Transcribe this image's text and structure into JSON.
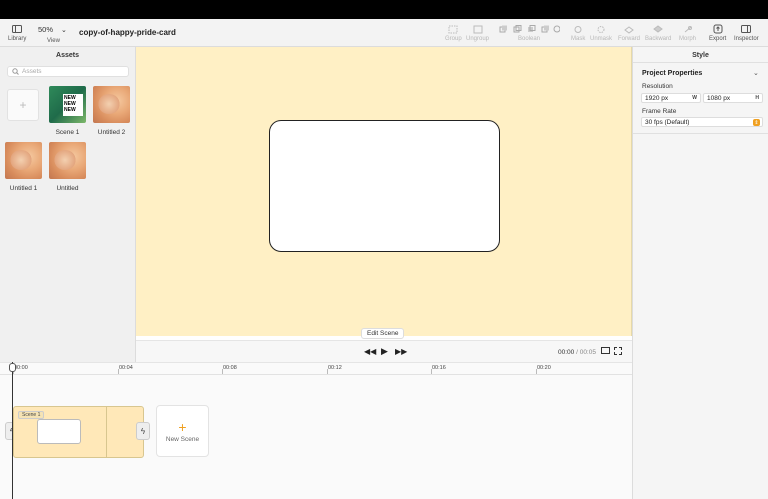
{
  "toolbar": {
    "library_label": "Library",
    "zoom_value": "50%",
    "view_label": "View",
    "doc_title": "copy-of-happy-pride-card",
    "group_label": "Group",
    "ungroup_label": "Ungroup",
    "boolean_label": "Boolean",
    "mask_label": "Mask",
    "unmask_label": "Unmask",
    "forward_label": "Forward",
    "backward_label": "Backward",
    "morph_label": "Morph",
    "export_label": "Export",
    "inspector_label": "Inspector"
  },
  "assets": {
    "title": "Assets",
    "search_placeholder": "Assets",
    "items": [
      {
        "label": "Scene 1"
      },
      {
        "label": "Untitled 2"
      },
      {
        "label": "Untitled 1"
      },
      {
        "label": "Untitled"
      }
    ],
    "scene_thumb_text": "NEW NEW NEW"
  },
  "canvas": {
    "edit_scene_label": "Edit Scene",
    "background_color": "#fff0c5"
  },
  "style_panel": {
    "tab": "Style",
    "section_title": "Project Properties",
    "resolution_label": "Resolution",
    "width_value": "1920 px",
    "width_unit": "W",
    "height_value": "1080 px",
    "height_unit": "H",
    "frame_rate_label": "Frame Rate",
    "frame_rate_value": "30 fps (Default)"
  },
  "playback": {
    "current_time": "00:00",
    "total_time": "/ 00:05"
  },
  "timeline": {
    "ticks": [
      "00:00",
      "00:04",
      "00:08",
      "00:12",
      "00:16",
      "00:20"
    ],
    "scene_tag": "Scene 1",
    "new_scene_label": "New Scene"
  },
  "colors": {
    "accent": "#f0a020",
    "scene_fill": "#ffe8b8"
  }
}
